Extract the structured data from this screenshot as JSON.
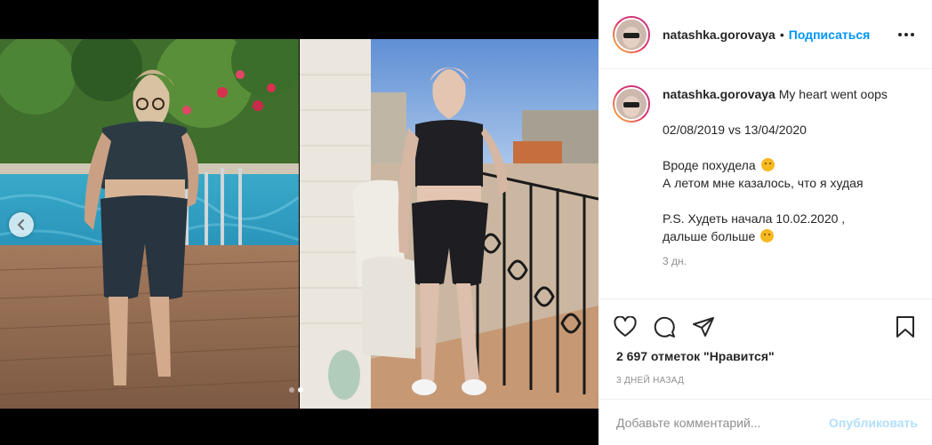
{
  "post": {
    "username": "natashka.gorovaya",
    "separator": "•",
    "follow_label": "Подписаться",
    "caption": {
      "username": "natashka.gorovaya",
      "first_line": "My heart went oops",
      "dates": "02/08/2019 vs 13/04/2020",
      "line_a": "Вроде похудела",
      "line_b": "А летом мне казалось, что я худая",
      "line_c": "P.S. Худеть начала 10.02.2020 ,",
      "line_d": "дальше больше",
      "time_short": "3 дн."
    },
    "likes": "2 697 отметок \"Нравится\"",
    "time_ago": "3 ДНЕЙ НАЗАД",
    "comment_placeholder": "Добавьте комментарий...",
    "publish_label": "Опубликовать"
  },
  "carousel": {
    "current": 2,
    "total": 2
  },
  "icons": {
    "prev": "chevron-left-icon",
    "like": "heart-icon",
    "comment": "comment-icon",
    "share": "share-icon",
    "save": "bookmark-icon",
    "more": "more-icon"
  },
  "colors": {
    "accent": "#0095f6",
    "publish_disabled": "#b2dffc",
    "muted": "#8e8e8e"
  }
}
